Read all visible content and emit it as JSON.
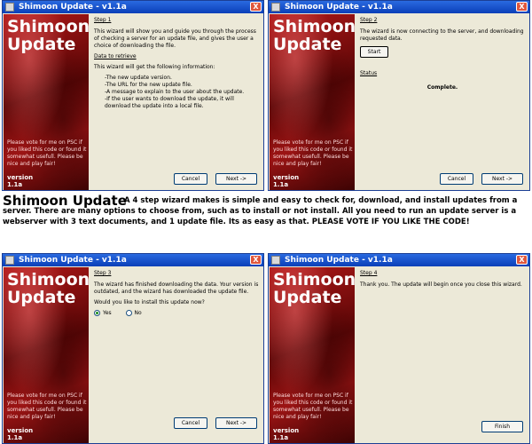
{
  "window_title": "Shimoon Update - v1.1a",
  "close_glyph": "X",
  "banner": {
    "title": "Shimoon Update",
    "vote": "Please vote for me on PSC if you liked this code or found it somewhat usefull. Please be nice and play fair!",
    "version_label": "version",
    "version": "1.1a"
  },
  "buttons": {
    "cancel": "Cancel",
    "next": "Next ->",
    "start": "Start",
    "finish": "Finish"
  },
  "step1": {
    "heading": "Step 1",
    "intro": "This wizard will show you and guide you through the process of checking a server for an update file, and gives the user a choice of downloading the file.",
    "data_label": "Data to retrieve",
    "info": "This wizard will get the following information:",
    "items": [
      "-The new update version.",
      "-The URL for the new update file.",
      "-A message to explain to the user about the update.",
      "-If the user wants to download the update, it will download the update into a local file."
    ]
  },
  "step2": {
    "heading": "Step 2",
    "intro": "The wizard is now connecting to the server, and downloading requested data.",
    "status_label": "Status",
    "status": "Complete."
  },
  "step3": {
    "heading": "Step 3",
    "intro": "The wizard has finished downloading the data. Your version is outdated, and the wizard has downloaded the update file.",
    "question": "Would you like to install this update now?",
    "yes": "Yes",
    "no": "No",
    "selected": "Yes"
  },
  "step4": {
    "heading": "Step 4",
    "intro": "Thank you. The update will begin once you close this wizard."
  },
  "caption": {
    "heading": "Shimoon Update",
    "text": "A 4 step wizard makes is simple and easy to check for, download, and install updates from a server. There are many options to choose from, such as to install or not install. All you need to run an update server is a webserver with 3 text documents, and 1 update file. Its as easy as that. PLEASE VOTE IF YOU LIKE THE CODE!"
  }
}
